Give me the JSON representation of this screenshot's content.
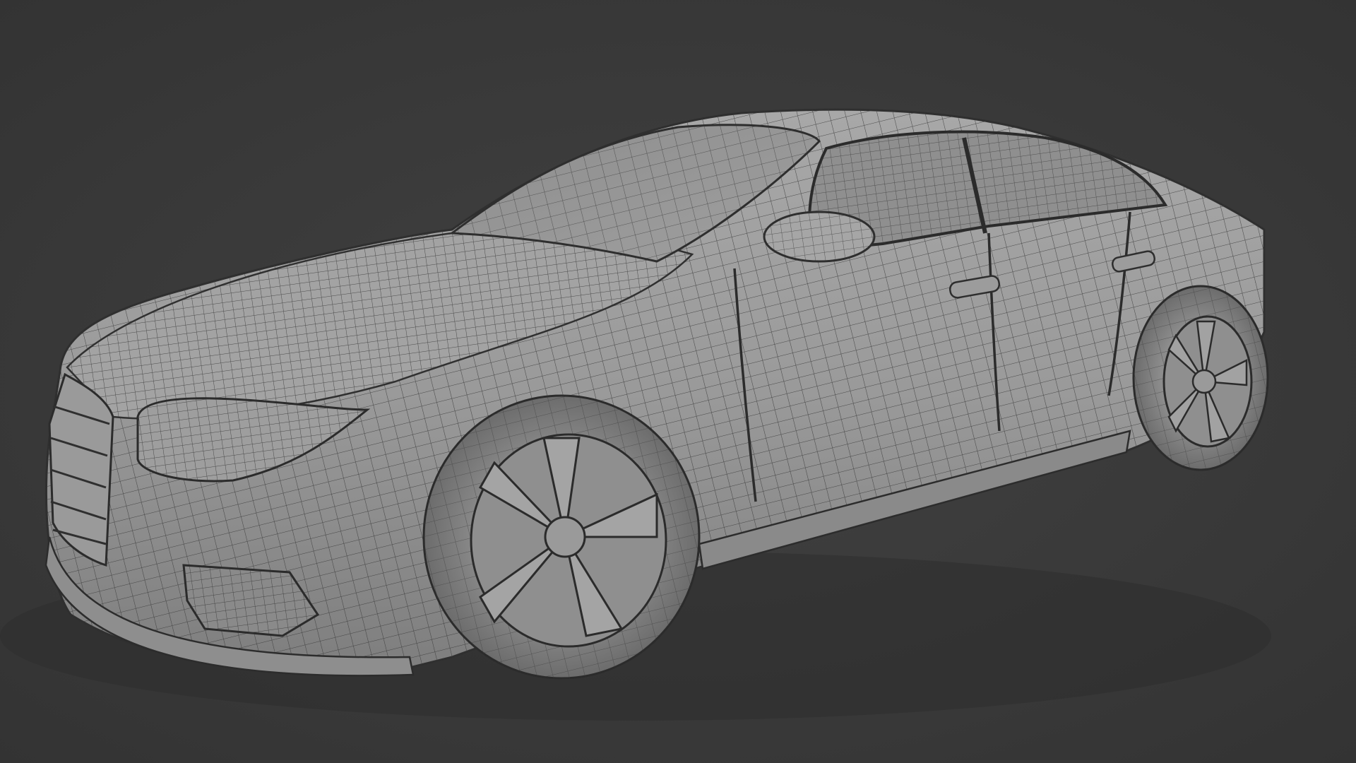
{
  "viewport": {
    "background_color": "#3b3b3b",
    "subject": "car-wireframe-render",
    "body_color": "#9a9a9a",
    "wire_color": "#3a3a3a",
    "shading": "solid-with-wireframe-overlay"
  }
}
